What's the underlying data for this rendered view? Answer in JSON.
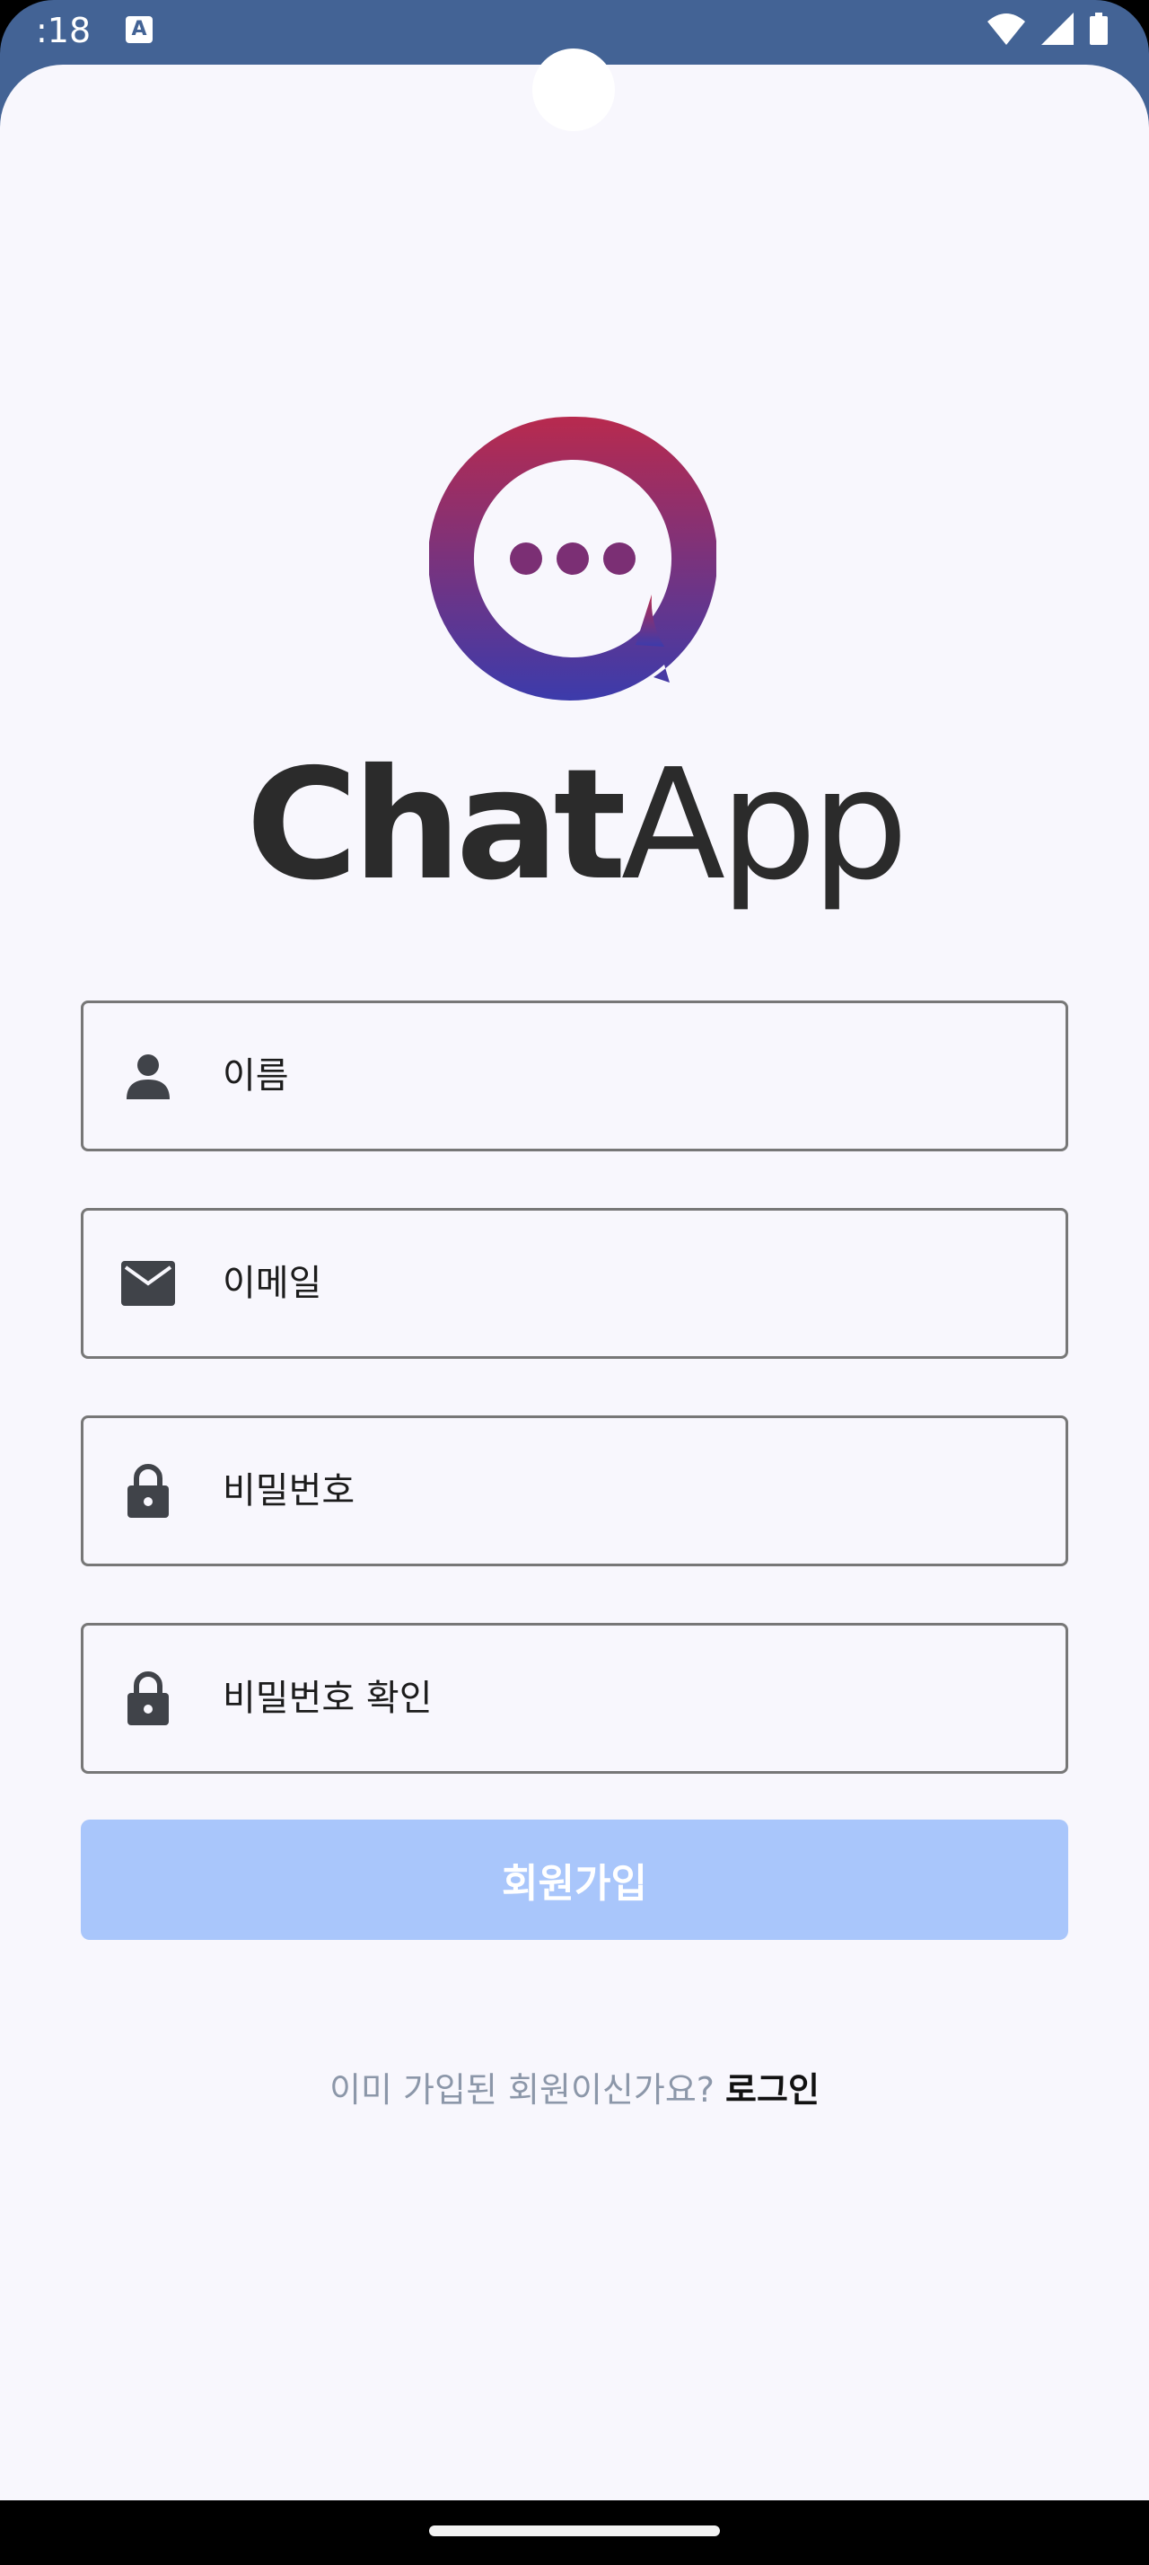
{
  "status_bar": {
    "time": ":18",
    "a_icon": "A",
    "icons": [
      "wifi-icon",
      "signal-icon",
      "battery-icon"
    ]
  },
  "app": {
    "name_bold": "Chat",
    "name_light": "App"
  },
  "form": {
    "name_placeholder": "이름",
    "email_placeholder": "이메일",
    "password_placeholder": "비밀번호",
    "password_confirm_placeholder": "비밀번호 확인",
    "submit_label": "회원가입"
  },
  "footer": {
    "question": "이미 가입된 회원이신가요?",
    "login_label": "로그인"
  },
  "colors": {
    "status_bar": "#436395",
    "background": "#f8f7fd",
    "button_disabled": "#a9c6fb",
    "logo_gradient_top": "#b82a4e",
    "logo_gradient_bottom": "#3c3bab"
  }
}
